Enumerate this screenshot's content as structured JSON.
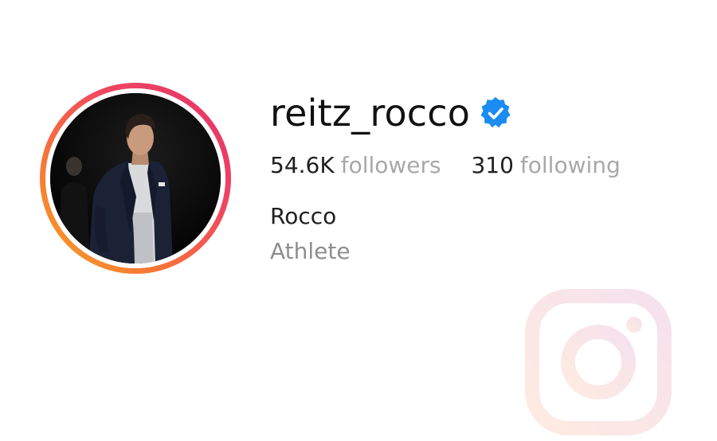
{
  "profile": {
    "username": "reitz_rocco",
    "verified": true,
    "followers_count": "54.6K",
    "followers_label": "followers",
    "following_count": "310",
    "following_label": "following",
    "full_name": "Rocco",
    "category": "Athlete"
  },
  "icons": {
    "verified_badge": "verified-badge-icon",
    "brand_watermark": "instagram-logo-icon",
    "avatar": "profile-photo"
  },
  "colors": {
    "verified_blue": "#0095f6",
    "ring_orange": "#f77737",
    "ring_pink": "#e1306c",
    "text_primary": "#111111",
    "text_secondary": "#a8a8a8"
  }
}
